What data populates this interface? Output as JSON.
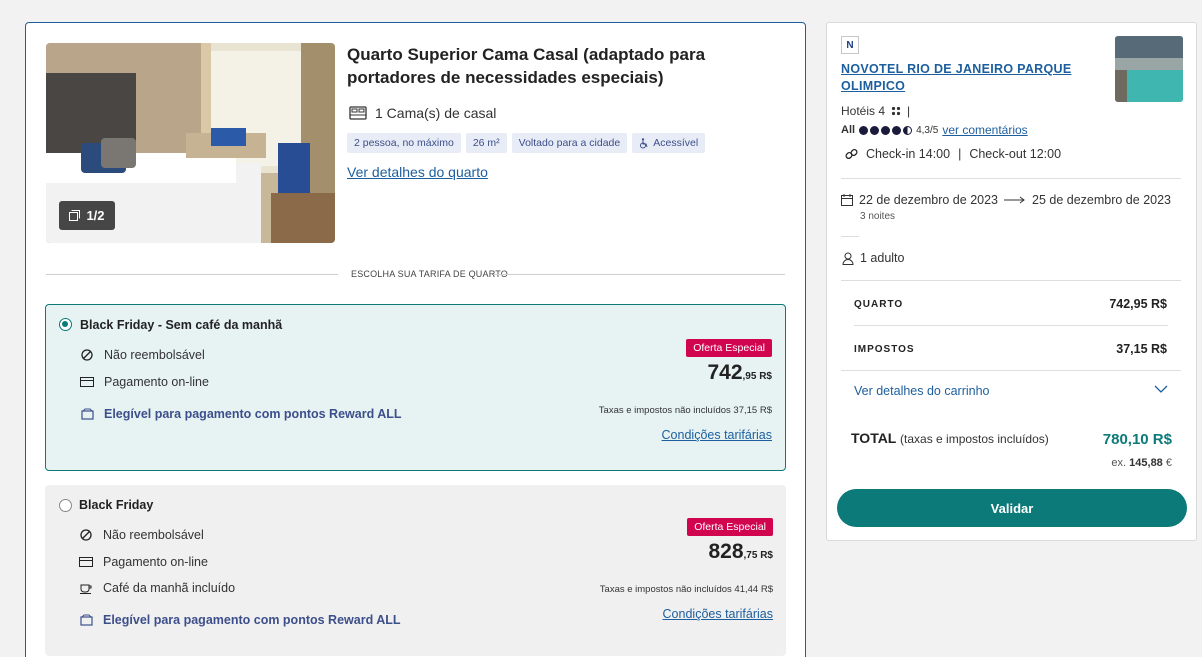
{
  "room": {
    "title": "Quarto Superior Cama Casal (adaptado para portadores de necessidades especiais)",
    "bed": "1 Cama(s) de casal",
    "tags": [
      "2 pessoa, no máximo",
      "26 m²",
      "Voltado para a cidade",
      "Acessível"
    ],
    "details_link": "Ver detalhes do quarto",
    "photo_counter": "1/2"
  },
  "rates_heading": "ESCOLHA SUA TARIFA DE QUARTO",
  "rates": [
    {
      "name": "Black Friday - Sem café da manhã",
      "selected": true,
      "features": [
        "Não reembolsável",
        "Pagamento on-line"
      ],
      "reward": "Elegível para pagamento com pontos Reward ALL",
      "badge": "Oferta Especial",
      "price_main": "742",
      "price_cents": ",95 R$",
      "tax_note": "Taxas e impostos não incluídos 37,15 R$",
      "conditions": "Condições tarifárias"
    },
    {
      "name": "Black Friday",
      "selected": false,
      "features": [
        "Não reembolsável",
        "Pagamento on-line",
        "Café da manhã incluído"
      ],
      "reward": "Elegível para pagamento com pontos Reward ALL",
      "badge": "Oferta Especial",
      "price_main": "828",
      "price_cents": ",75 R$",
      "tax_note": "Taxas e impostos não incluídos 41,44 R$",
      "conditions": "Condições tarifárias"
    }
  ],
  "summary": {
    "brand_letter": "N",
    "hotel_name": "NOVOTEL RIO DE JANEIRO PARQUE OLIMPICO",
    "category": "Hotéis 4",
    "rating_brand": "All",
    "rating_score": "4,3/5",
    "reviews_link": "ver comentários",
    "checkin": "Check-in 14:00",
    "checkout": "Check-out 12:00",
    "date_from": "22 de dezembro de 2023",
    "date_to": "25 de dezembro de 2023",
    "nights": "3 noites",
    "guests": "1 adulto",
    "room_label": "QUARTO",
    "room_value": "742,95 R$",
    "tax_label": "IMPOSTOS",
    "tax_value": "37,15 R$",
    "cart_link": "Ver detalhes do carrinho",
    "total_label": "TOTAL",
    "total_note": "(taxas e impostos incluídos)",
    "total_value": "780,10 R$",
    "total_alt_prefix": "ex.",
    "total_alt_value": "145,88",
    "total_alt_currency": "€",
    "validate": "Validar"
  },
  "colors": {
    "teal": "#0b7a79",
    "link": "#1c5e9e",
    "badge": "#d1044f"
  }
}
